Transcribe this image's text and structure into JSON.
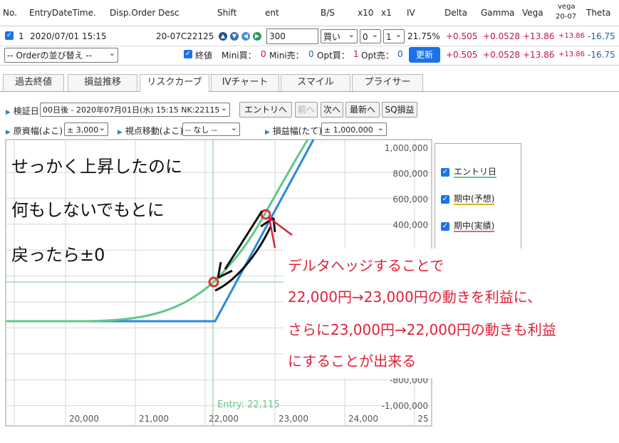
{
  "header": {
    "no": "No.",
    "entry_date": "EntryDateTime.",
    "disp_desc": "Disp.Order Desc",
    "shift": "Shift",
    "ent": "ent",
    "bs": "B/S",
    "x10": "x10",
    "x1": "x1",
    "iv": "IV",
    "delta": "Delta",
    "gamma": "Gamma",
    "vega": "Vega",
    "vega_small_1": "vega",
    "vega_small_2": "20-07",
    "theta": "Theta"
  },
  "order_row": {
    "no": "1",
    "date": "2020/07/01 15:15",
    "desc": "20-07C22125",
    "ent_value": "300",
    "bs_value": "買い",
    "x10_value": "0",
    "x1_value": "1",
    "iv": "21.75%",
    "delta": "+0.505",
    "gamma": "+0.0528",
    "vega": "+13.86",
    "vega_small": "+13.86",
    "theta": "-16.75"
  },
  "summary_row": {
    "sort_select": "-- Orderの並び替え --",
    "close_label": "終値",
    "mini_buy_label": "Mini買：",
    "mini_buy": "0",
    "mini_sell_label": "Mini売：",
    "mini_sell": "0",
    "opt_buy_label": "Opt買：",
    "opt_buy": "1",
    "opt_sell_label": "Opt売：",
    "opt_sell": "0",
    "update_button": "更新",
    "delta": "+0.505",
    "gamma": "+0.0528",
    "vega": "+13.86",
    "vega_small": "+13.86",
    "theta": "-16.75"
  },
  "tabs": [
    "過去終値",
    "損益推移",
    "リスクカーブ",
    "IVチャート",
    "スマイル",
    "プライサー"
  ],
  "controls": {
    "verify_label": "検証日",
    "verify_value": "00日後 - 2020年07月01日(水) 15:15 NK:22115",
    "entry_btn": "エントリへ",
    "prev_btn": "前へ",
    "next_btn": "次へ",
    "latest_btn": "最新へ",
    "sq_btn": "SQ損益",
    "xrange_label": "原資幅(よこ)",
    "xrange_value": "± 3,000",
    "view_label": "視点移動(よこ)",
    "view_value": "-- なし --",
    "yrange_label": "損益幅(たて)",
    "yrange_value": "± 1,000,000"
  },
  "chart": {
    "y_ticks": [
      "1,000,000",
      "800,000",
      "600,000",
      "400,000",
      "-800,000",
      "-1,000,000"
    ],
    "x_ticks": [
      "20,000",
      "21,000",
      "22,000",
      "23,000",
      "24,000",
      "25"
    ],
    "entry_label": "Entry: 22,115",
    "colors": {
      "entry": "#5ec98a",
      "expiry": "#2b8ad8",
      "grid": "#d6d6d6",
      "hline": "#8fcf9f"
    }
  },
  "legend": [
    "エントリ日",
    "期中(予想)",
    "期中(実績)"
  ],
  "legend_colors": [
    "#5ec98a",
    "#d8b020",
    "#e060a0"
  ],
  "note_lines": [
    "せっかく上昇したのに",
    "何もしないでもとに",
    "戻ったら±0"
  ],
  "callout_lines": [
    "デルタヘッジすることで",
    "22,000円→23,000円の動きを利益に、",
    "さらに23,000円→22,000円の動きも利益",
    "にすることが出来る"
  ]
}
